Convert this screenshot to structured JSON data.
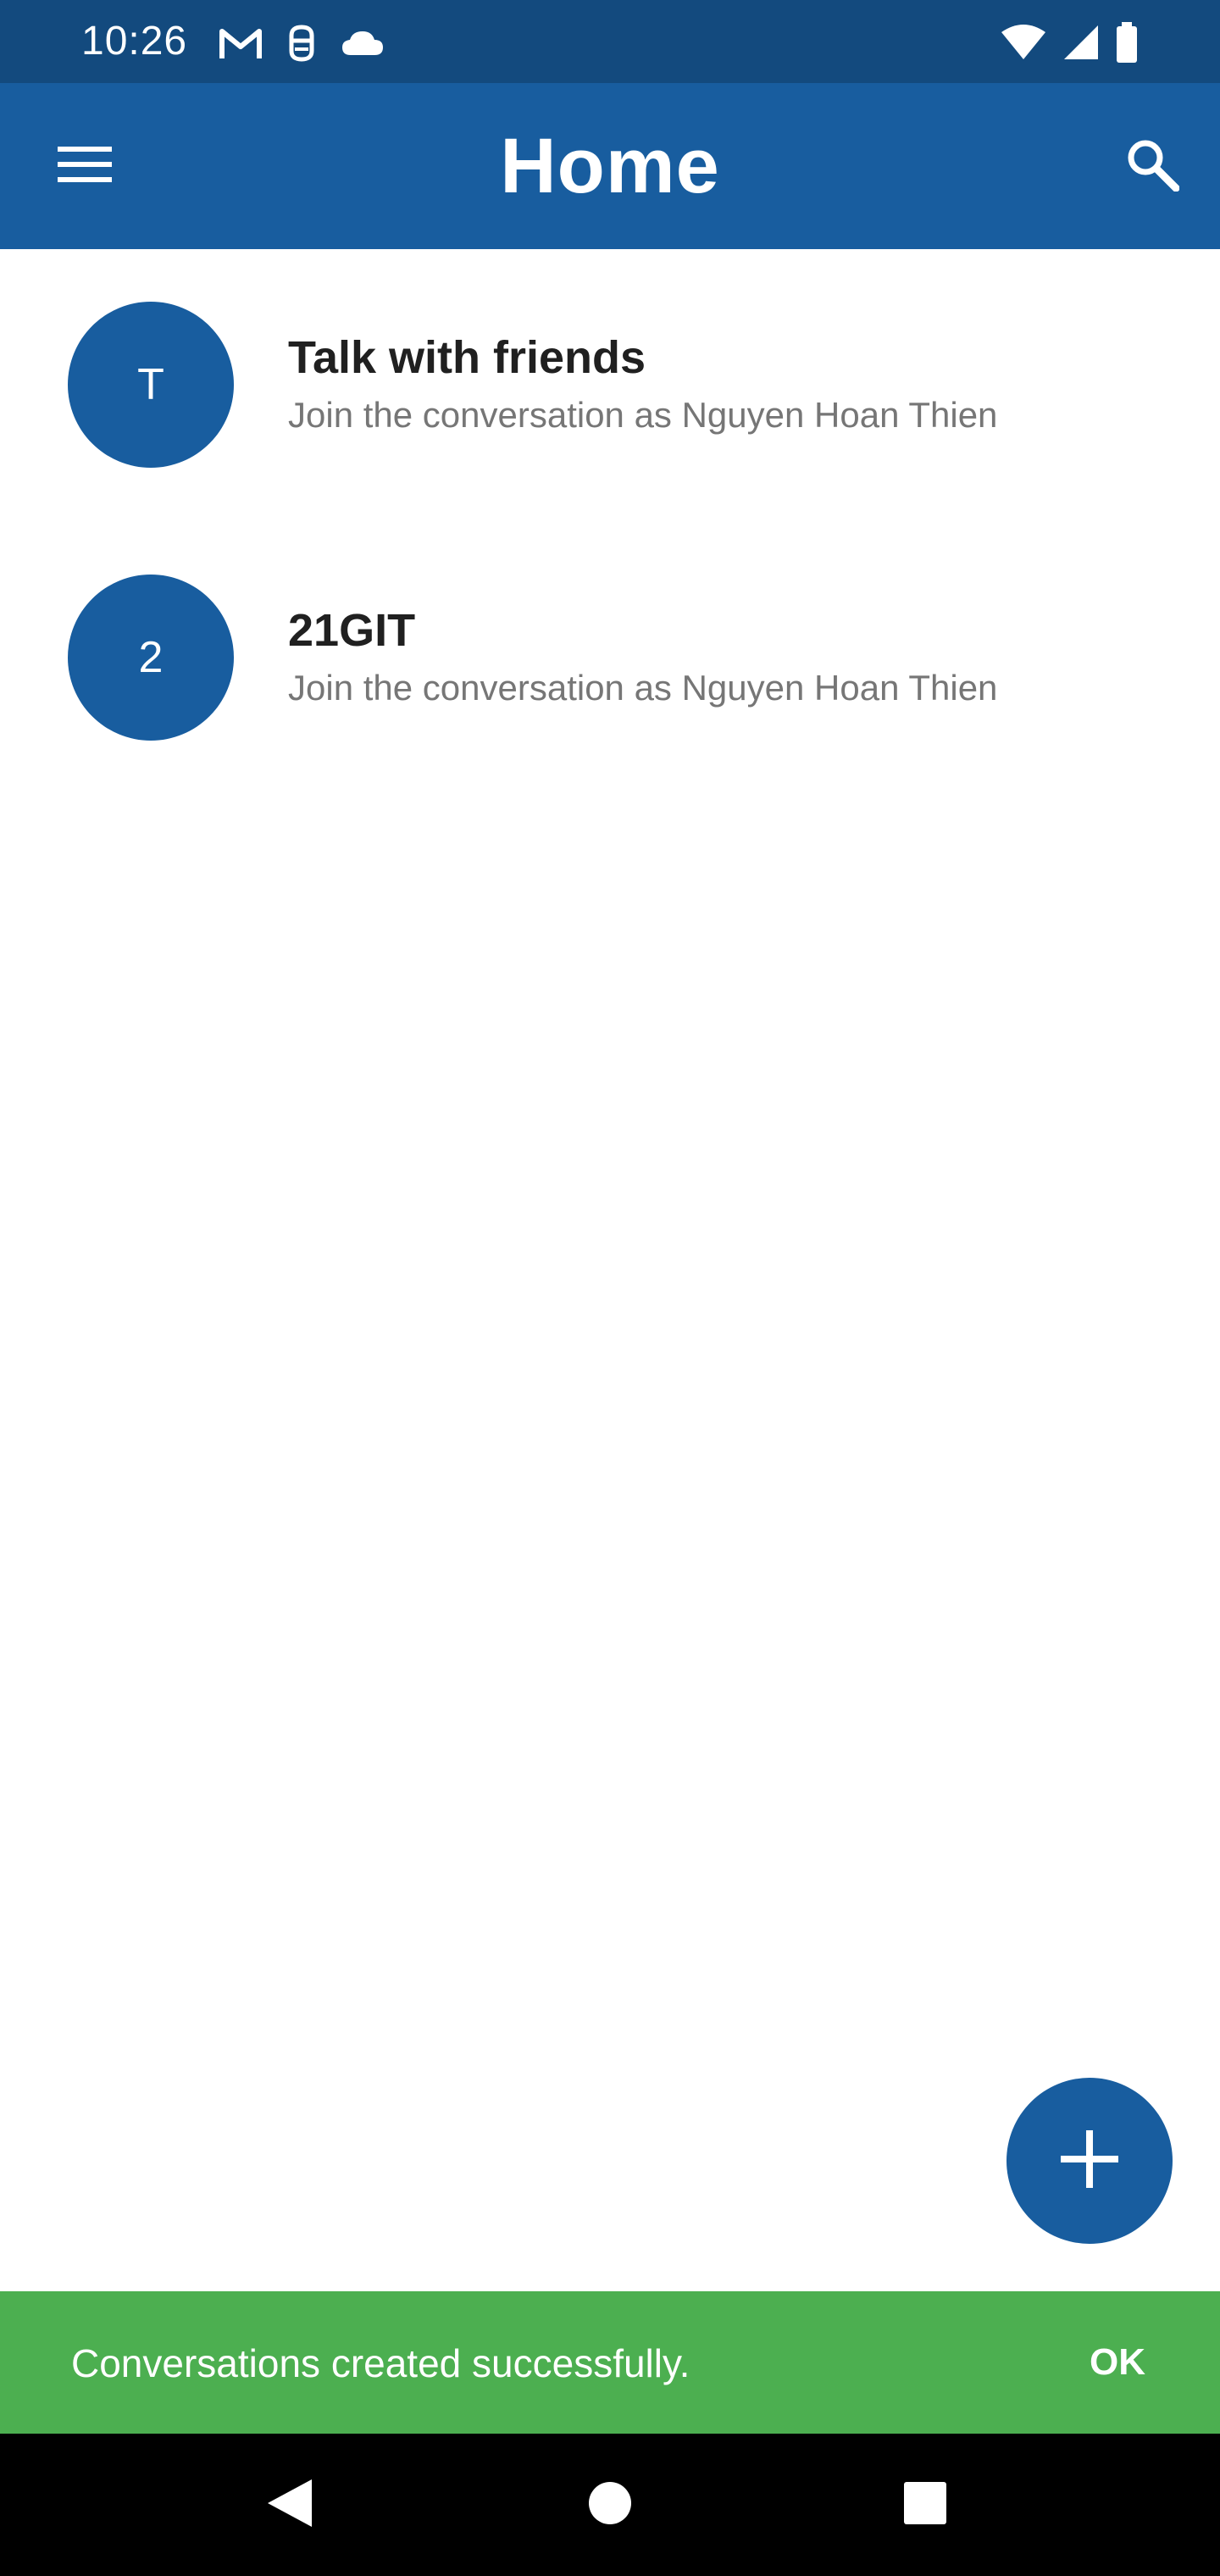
{
  "status_bar": {
    "time": "10:26",
    "left_icons": [
      "gmail-icon",
      "app-notification-icon",
      "cloud-icon"
    ],
    "right_icons": [
      "wifi-icon",
      "signal-icon",
      "battery-icon"
    ]
  },
  "app_bar": {
    "title": "Home",
    "left_icon": "menu-icon",
    "right_icon": "search-icon"
  },
  "conversations": [
    {
      "avatar_letter": "T",
      "title": "Talk with friends",
      "subtitle": "Join the conversation as Nguyen Hoan Thien"
    },
    {
      "avatar_letter": "2",
      "title": "21GIT",
      "subtitle": "Join the conversation as Nguyen Hoan Thien"
    }
  ],
  "fab": {
    "icon": "plus-icon"
  },
  "snackbar": {
    "message": "Conversations created successfully.",
    "action_label": "OK"
  },
  "nav_bar": {
    "icons": [
      "back-icon",
      "home-icon",
      "recents-icon"
    ]
  },
  "colors": {
    "status_bar": "#134a7e",
    "primary": "#185d9f",
    "snackbar": "#4caf50",
    "title_text": "#202020",
    "subtitle_text": "#767676"
  }
}
